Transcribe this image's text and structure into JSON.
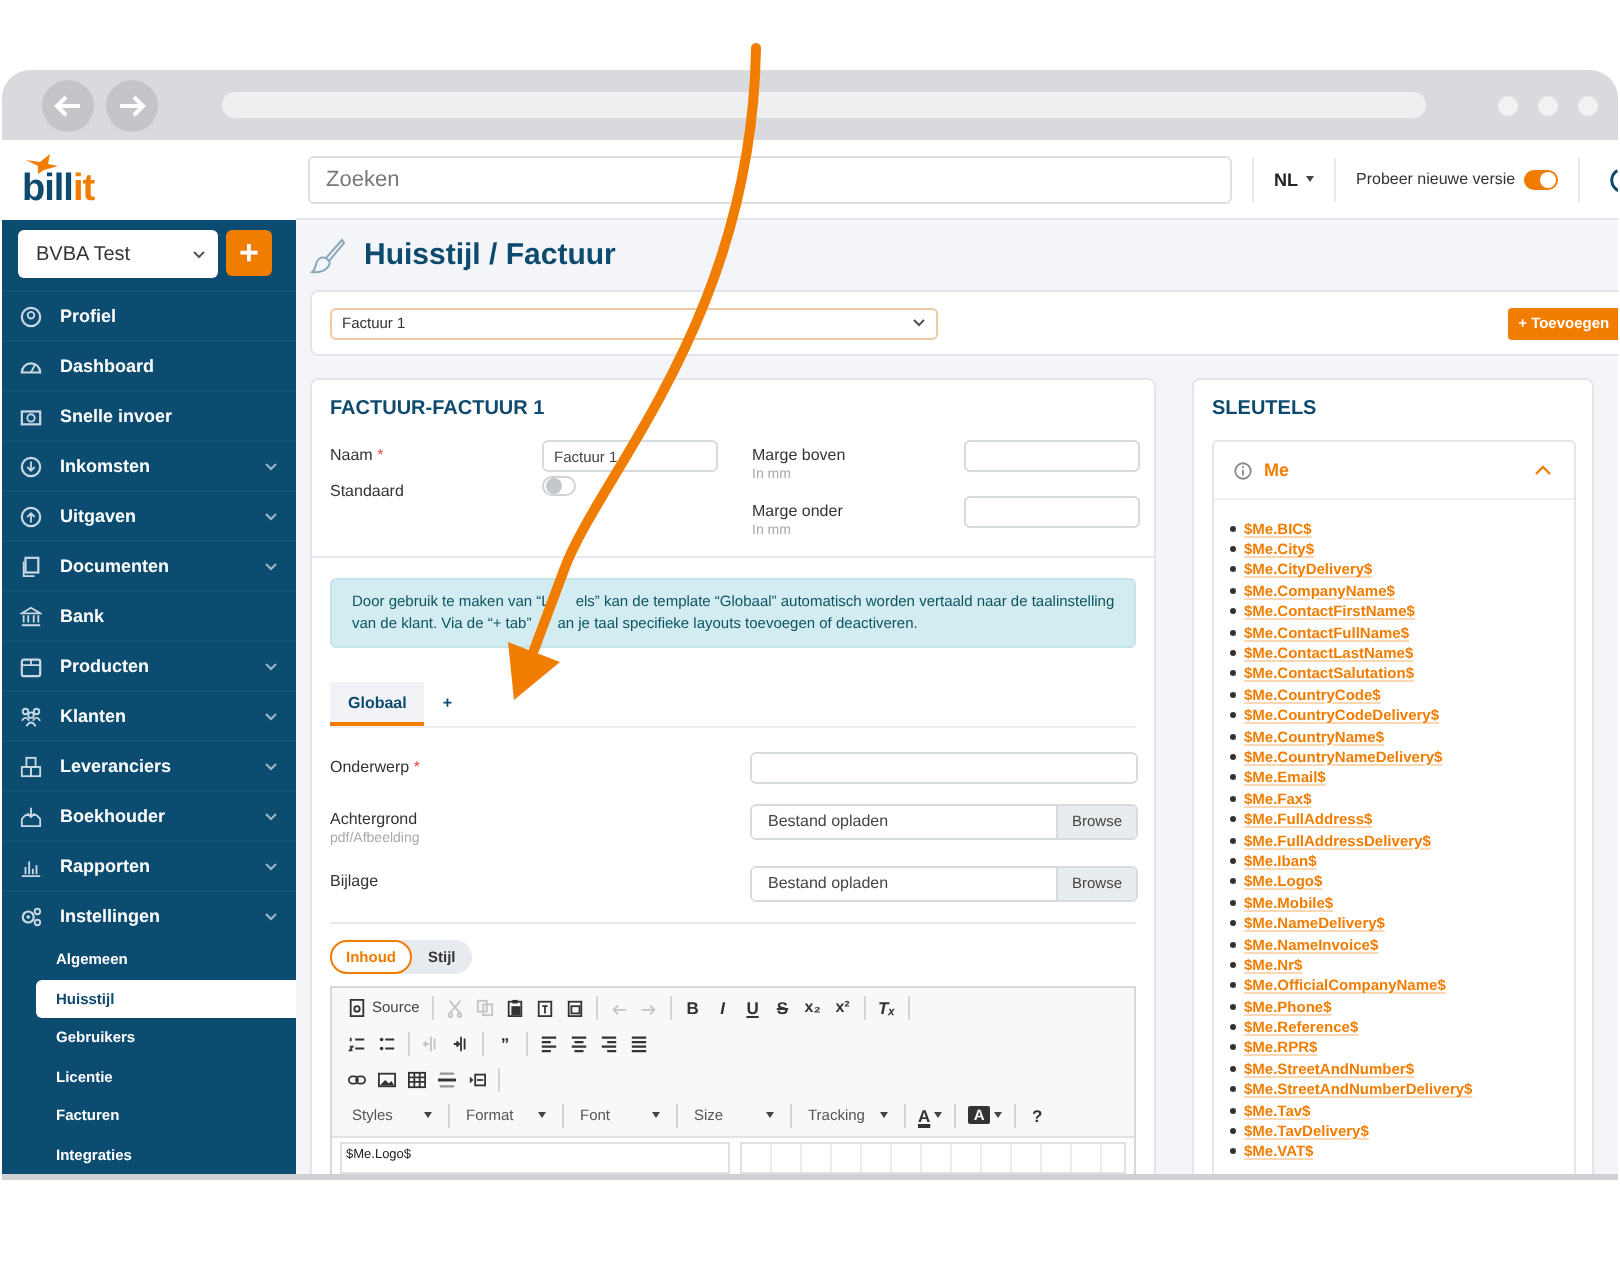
{
  "logo": {
    "parts": [
      "bill",
      "it"
    ]
  },
  "header": {
    "search": {
      "placeholder": "Zoeken"
    },
    "language": "NL",
    "new_version": {
      "label": "Probeer nieuwe versie",
      "on": true
    }
  },
  "sidebar": {
    "company": "BVBA Test",
    "add_label": "+",
    "items": [
      {
        "label": "Profiel",
        "kind": "link"
      },
      {
        "label": "Dashboard",
        "kind": "link"
      },
      {
        "label": "Snelle invoer",
        "kind": "link"
      },
      {
        "label": "Inkomsten",
        "kind": "group"
      },
      {
        "label": "Uitgaven",
        "kind": "group"
      },
      {
        "label": "Documenten",
        "kind": "group"
      },
      {
        "label": "Bank",
        "kind": "link"
      },
      {
        "label": "Producten",
        "kind": "group"
      },
      {
        "label": "Klanten",
        "kind": "group"
      },
      {
        "label": "Leveranciers",
        "kind": "group"
      },
      {
        "label": "Boekhouder",
        "kind": "group"
      },
      {
        "label": "Rapporten",
        "kind": "group"
      },
      {
        "label": "Instellingen",
        "kind": "group",
        "children": [
          {
            "label": "Algemeen",
            "selected": false
          },
          {
            "label": "Huisstijl",
            "selected": true
          },
          {
            "label": "Gebruikers",
            "selected": false
          },
          {
            "label": "Licentie",
            "selected": false
          },
          {
            "label": "Facturen",
            "selected": false
          },
          {
            "label": "Integraties",
            "selected": false
          }
        ]
      }
    ]
  },
  "page": {
    "title": "Huisstijl / Factuur",
    "template_select": "Factuur 1",
    "add_button": "+ Toevoegen"
  },
  "form": {
    "heading": "FACTUUR-FACTUUR 1",
    "name": {
      "label": "Naam",
      "required_mark": "*",
      "value": "Factuur 1"
    },
    "default": {
      "label": "Standaard",
      "on": false
    },
    "margins": [
      {
        "label": "Marge boven",
        "hint": "In mm"
      },
      {
        "label": "Marge onder",
        "hint": "In mm"
      }
    ],
    "info_lines": [
      [
        "Door gebruik te maken van “L",
        "els” kan de template “Globaal” automatisch worden vertaald naar de taalinstelling"
      ],
      [
        "van de klant. Via de “+ tab”",
        "an je taal specifieke layouts toevoegen of deactiveren."
      ]
    ],
    "language_tabs": [
      {
        "label": "Globaal",
        "selected": true
      },
      {
        "label": "+",
        "selected": false
      }
    ],
    "subject": {
      "label": "Onderwerp",
      "required_mark": "*"
    },
    "uploads": [
      {
        "label": "Achtergrond",
        "hint": "pdf/Afbeelding",
        "placeholder": "Bestand opladen",
        "button": "Browse"
      },
      {
        "label": "Bijlage",
        "placeholder": "Bestand opladen",
        "button": "Browse"
      }
    ],
    "content_tabs": [
      {
        "label": "Inhoud",
        "selected": true
      },
      {
        "label": "Stijl",
        "selected": false
      }
    ],
    "editor": {
      "toolbar": [
        [
          {
            "kind": "source",
            "label": "Source"
          },
          {
            "kind": "sep"
          },
          {
            "kind": "cut",
            "disabled": true
          },
          {
            "kind": "copy",
            "disabled": true
          },
          {
            "kind": "paste",
            "disabled": false
          },
          {
            "kind": "paste-text",
            "disabled": false
          },
          {
            "kind": "paste-word",
            "disabled": false
          },
          {
            "kind": "sep"
          },
          {
            "kind": "undo",
            "disabled": true
          },
          {
            "kind": "redo",
            "disabled": true
          },
          {
            "kind": "sep"
          },
          {
            "kind": "bold",
            "label": "B"
          },
          {
            "kind": "italic",
            "label": "I"
          },
          {
            "kind": "underline",
            "label": "U"
          },
          {
            "kind": "strike",
            "label": "S"
          },
          {
            "kind": "glyph",
            "label": "x₂"
          },
          {
            "kind": "glyph",
            "label": "x²"
          },
          {
            "kind": "sep"
          },
          {
            "kind": "italic",
            "label": "Tₓ"
          },
          {
            "kind": "sep"
          }
        ],
        [
          {
            "kind": "numbered-list",
            "disabled": false
          },
          {
            "kind": "bullet-list",
            "disabled": false
          },
          {
            "kind": "sep"
          },
          {
            "kind": "outdent",
            "disabled": true
          },
          {
            "kind": "indent",
            "disabled": false
          },
          {
            "kind": "sep"
          },
          {
            "kind": "bold",
            "label": "”"
          },
          {
            "kind": "sep"
          },
          {
            "kind": "align-left",
            "disabled": false
          },
          {
            "kind": "align-center",
            "disabled": false
          },
          {
            "kind": "align-right",
            "disabled": false
          },
          {
            "kind": "justify",
            "disabled": false
          }
        ],
        [
          {
            "kind": "link",
            "disabled": false
          },
          {
            "kind": "image",
            "disabled": false
          },
          {
            "kind": "table",
            "disabled": false
          },
          {
            "kind": "rule",
            "disabled": false
          },
          {
            "kind": "pagebreak",
            "disabled": false
          },
          {
            "kind": "sep"
          }
        ],
        [
          {
            "kind": "dropdown",
            "label": "Styles"
          },
          {
            "kind": "sep"
          },
          {
            "kind": "dropdown",
            "label": "Format"
          },
          {
            "kind": "sep"
          },
          {
            "kind": "dropdown",
            "label": "Font"
          },
          {
            "kind": "sep"
          },
          {
            "kind": "dropdown",
            "label": "Size"
          },
          {
            "kind": "sep"
          },
          {
            "kind": "dropdown",
            "label": "Tracking"
          },
          {
            "kind": "sep"
          },
          {
            "kind": "text-color",
            "label": "A"
          },
          {
            "kind": "sep"
          },
          {
            "kind": "bg-color",
            "label": "A"
          },
          {
            "kind": "sep"
          },
          {
            "kind": "bold",
            "label": "?"
          }
        ]
      ],
      "content": "$Me.Logo$"
    }
  },
  "keys": {
    "title": "SLEUTELS",
    "group": {
      "label": "Me",
      "expanded": true,
      "items": [
        "$Me.BIC$",
        "$Me.City$",
        "$Me.CityDelivery$",
        "$Me.CompanyName$",
        "$Me.ContactFirstName$",
        "$Me.ContactFullName$",
        "$Me.ContactLastName$",
        "$Me.ContactSalutation$",
        "$Me.CountryCode$",
        "$Me.CountryCodeDelivery$",
        "$Me.CountryName$",
        "$Me.CountryNameDelivery$",
        "$Me.Email$",
        "$Me.Fax$",
        "$Me.FullAddress$",
        "$Me.FullAddressDelivery$",
        "$Me.Iban$",
        "$Me.Logo$",
        "$Me.Mobile$",
        "$Me.NameDelivery$",
        "$Me.NameInvoice$",
        "$Me.Nr$",
        "$Me.OfficialCompanyName$",
        "$Me.Phone$",
        "$Me.Reference$",
        "$Me.RPR$",
        "$Me.StreetAndNumber$",
        "$Me.StreetAndNumberDelivery$",
        "$Me.Tav$",
        "$Me.TavDelivery$",
        "$Me.VAT$"
      ]
    }
  }
}
